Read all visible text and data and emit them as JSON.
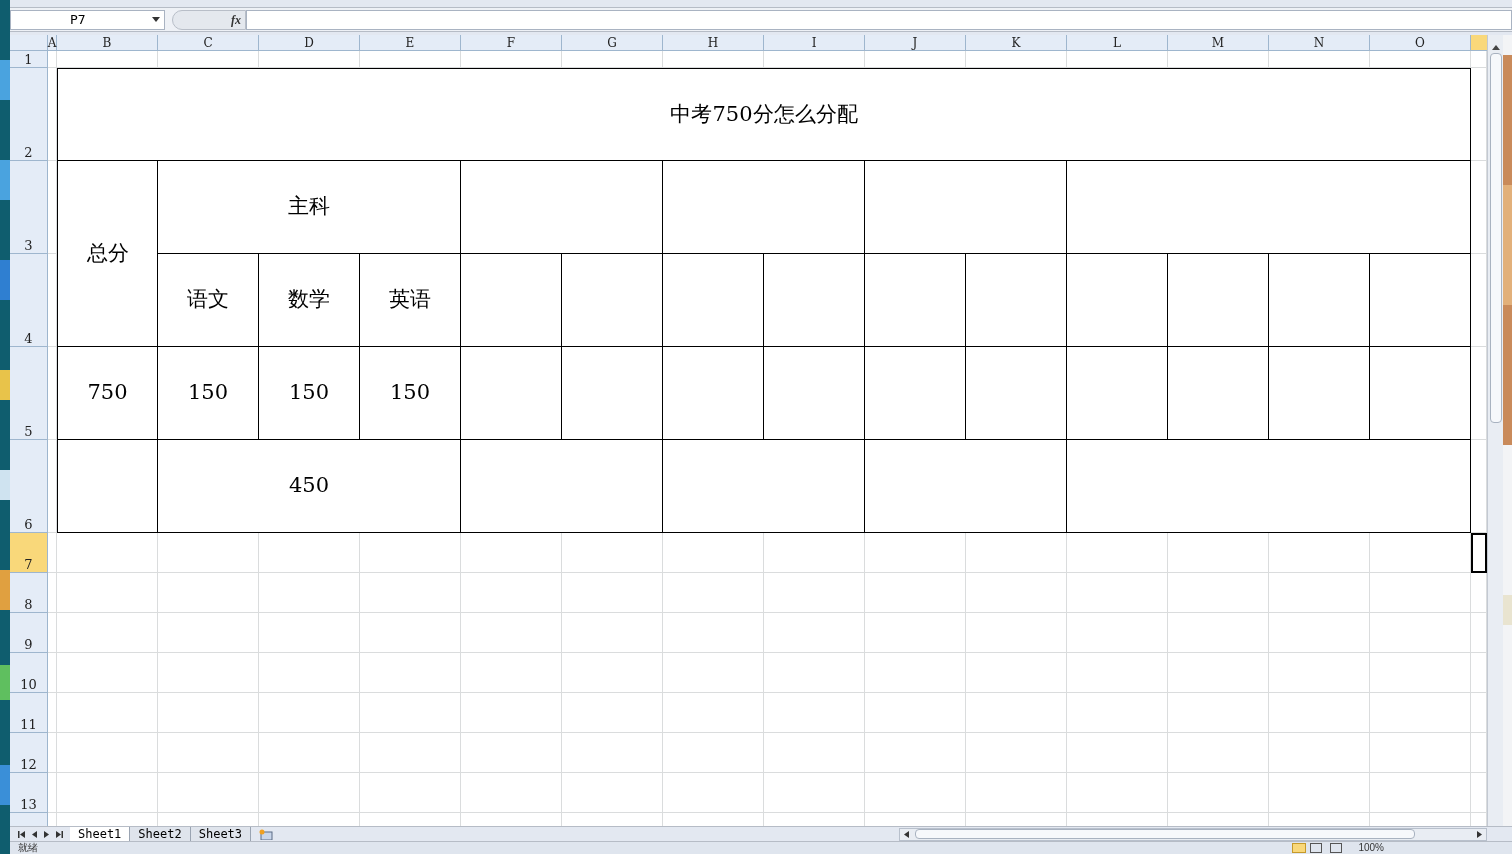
{
  "formula_bar": {
    "name_box": "P7",
    "function_label": "fx"
  },
  "column_headers": [
    {
      "label": "A",
      "selected": false
    },
    {
      "label": "B",
      "selected": false
    },
    {
      "label": "C",
      "selected": false
    },
    {
      "label": "D",
      "selected": false
    },
    {
      "label": "E",
      "selected": false
    },
    {
      "label": "F",
      "selected": false
    },
    {
      "label": "G",
      "selected": false
    },
    {
      "label": "H",
      "selected": false
    },
    {
      "label": "I",
      "selected": false
    },
    {
      "label": "J",
      "selected": false
    },
    {
      "label": "K",
      "selected": false
    },
    {
      "label": "L",
      "selected": false
    },
    {
      "label": "M",
      "selected": false
    },
    {
      "label": "N",
      "selected": false
    },
    {
      "label": "O",
      "selected": false
    }
  ],
  "row_headers": [
    {
      "label": "1",
      "selected": false
    },
    {
      "label": "2",
      "selected": false
    },
    {
      "label": "3",
      "selected": false
    },
    {
      "label": "4",
      "selected": false
    },
    {
      "label": "5",
      "selected": false
    },
    {
      "label": "6",
      "selected": false
    },
    {
      "label": "7",
      "selected": true
    },
    {
      "label": "8",
      "selected": false
    },
    {
      "label": "9",
      "selected": false
    },
    {
      "label": "10",
      "selected": false
    },
    {
      "label": "11",
      "selected": false
    },
    {
      "label": "12",
      "selected": false
    },
    {
      "label": "13",
      "selected": false
    }
  ],
  "table_cells": [
    "中考750分怎么分配",
    "总分",
    "主科",
    "语文",
    "数学",
    "英语",
    "750",
    "150",
    "150",
    "150",
    "450"
  ],
  "sheet_tabs": [
    {
      "label": "Sheet1",
      "selected": true
    },
    {
      "label": "Sheet2",
      "selected": false
    },
    {
      "label": "Sheet3",
      "selected": false
    }
  ],
  "status_bar": {
    "status": "就绪",
    "zoom": "100%"
  }
}
